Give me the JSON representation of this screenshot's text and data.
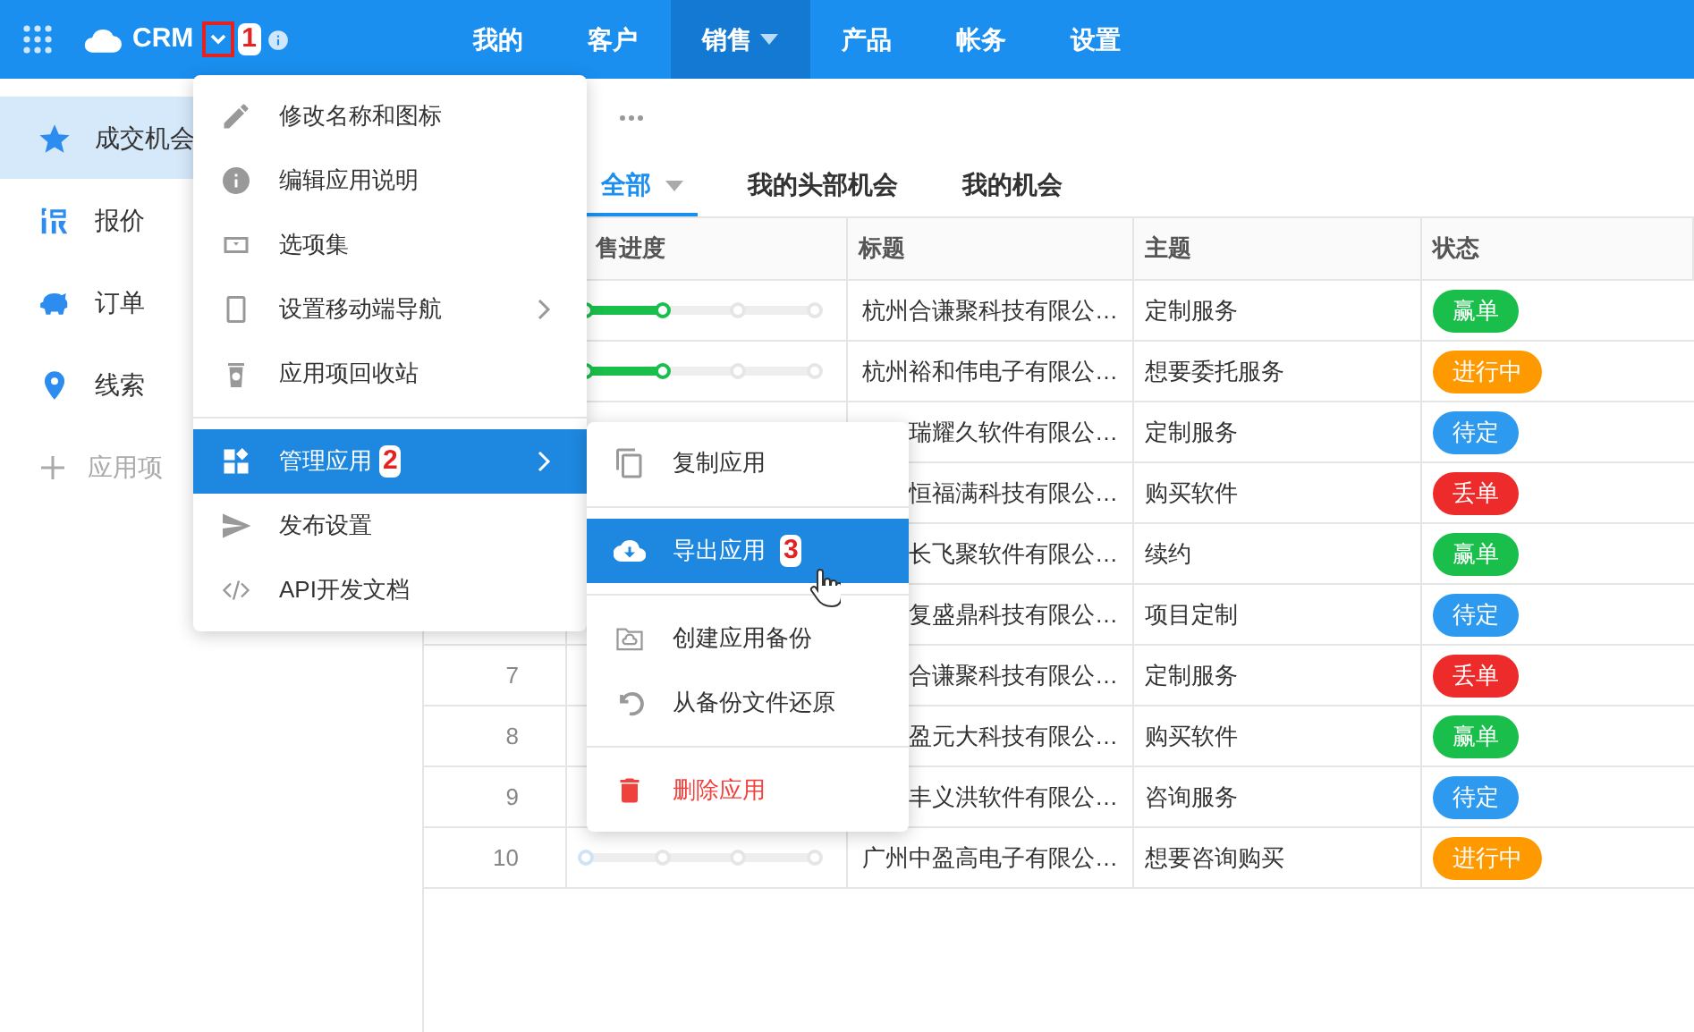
{
  "topbar": {
    "app_name": "CRM",
    "annotation": "1",
    "nav": [
      {
        "label": "我的",
        "selected": false,
        "dropdown": false
      },
      {
        "label": "客户",
        "selected": false,
        "dropdown": false
      },
      {
        "label": "销售",
        "selected": true,
        "dropdown": true
      },
      {
        "label": "产品",
        "selected": false,
        "dropdown": false
      },
      {
        "label": "帐务",
        "selected": false,
        "dropdown": false
      },
      {
        "label": "设置",
        "selected": false,
        "dropdown": false
      }
    ]
  },
  "sidebar": {
    "items": [
      {
        "label": "成交机会",
        "selected": true
      },
      {
        "label": "报价",
        "selected": false
      },
      {
        "label": "订单",
        "selected": false
      },
      {
        "label": "线索",
        "selected": false
      }
    ],
    "add_label": "应用项"
  },
  "page": {
    "tabs": [
      {
        "label": "全部",
        "selected": true,
        "dropdown": true
      },
      {
        "label": "我的头部机会",
        "selected": false,
        "dropdown": false
      },
      {
        "label": "我的机会",
        "selected": false,
        "dropdown": false
      }
    ]
  },
  "table": {
    "columns": [
      "售进度",
      "标题",
      "主题",
      "状态"
    ],
    "rows": [
      {
        "title": "杭州合谦聚科技有限公…",
        "topic": "定制服务",
        "status": "赢单",
        "color": "#19be4b",
        "level": 0.33
      },
      {
        "title": "杭州裕和伟电子有限公…",
        "topic": "想要委托服务",
        "status": "进行中",
        "color": "#ff9900",
        "level": 0.33
      },
      {
        "title": "瑞耀久软件有限公…",
        "topic": "定制服务",
        "status": "待定",
        "color": "#2d9af0"
      },
      {
        "title": "恒福满科技有限公…",
        "topic": "购买软件",
        "status": "丢单",
        "color": "#ed2b2b"
      },
      {
        "title": "长飞聚软件有限公…",
        "topic": "续约",
        "status": "赢单",
        "color": "#19be4b"
      },
      {
        "title": "复盛鼎科技有限公…",
        "topic": "项目定制",
        "status": "待定",
        "color": "#2d9af0"
      },
      {
        "number": "7",
        "title": "合谦聚科技有限公…",
        "topic": "定制服务",
        "status": "丢单",
        "color": "#ed2b2b"
      },
      {
        "number": "8",
        "title": "盈元大科技有限公…",
        "topic": "购买软件",
        "status": "赢单",
        "color": "#19be4b"
      },
      {
        "number": "9",
        "title": "丰义洪软件有限公…",
        "topic": "咨询服务",
        "status": "待定",
        "color": "#2d9af0"
      },
      {
        "number": "10",
        "title": "广州中盈高电子有限公…",
        "topic": "想要咨询购买",
        "status": "进行中",
        "color": "#ff9900",
        "level": 0
      }
    ]
  },
  "app_menu": {
    "groups": [
      [
        {
          "label": "修改名称和图标",
          "selected": false,
          "submenu": false
        },
        {
          "label": "编辑应用说明",
          "selected": false,
          "submenu": false
        },
        {
          "label": "选项集",
          "selected": false,
          "submenu": false
        },
        {
          "label": "设置移动端导航",
          "selected": false,
          "submenu": true
        },
        {
          "label": "应用项回收站",
          "selected": false,
          "submenu": false
        }
      ],
      [
        {
          "label": "管理应用",
          "selected": true,
          "submenu": true,
          "annotation": "2"
        },
        {
          "label": "发布设置",
          "selected": false,
          "submenu": false
        },
        {
          "label": "API开发文档",
          "selected": false,
          "submenu": false
        }
      ]
    ]
  },
  "manage_submenu": {
    "groups": [
      [
        {
          "label": "复制应用",
          "selected": false,
          "danger": false
        }
      ],
      [
        {
          "label": "导出应用",
          "selected": true,
          "danger": false,
          "annotation": "3"
        }
      ],
      [
        {
          "label": "创建应用备份",
          "selected": false,
          "danger": false
        },
        {
          "label": "从备份文件还原",
          "selected": false,
          "danger": false
        }
      ],
      [
        {
          "label": "删除应用",
          "selected": false,
          "danger": true
        }
      ]
    ]
  }
}
